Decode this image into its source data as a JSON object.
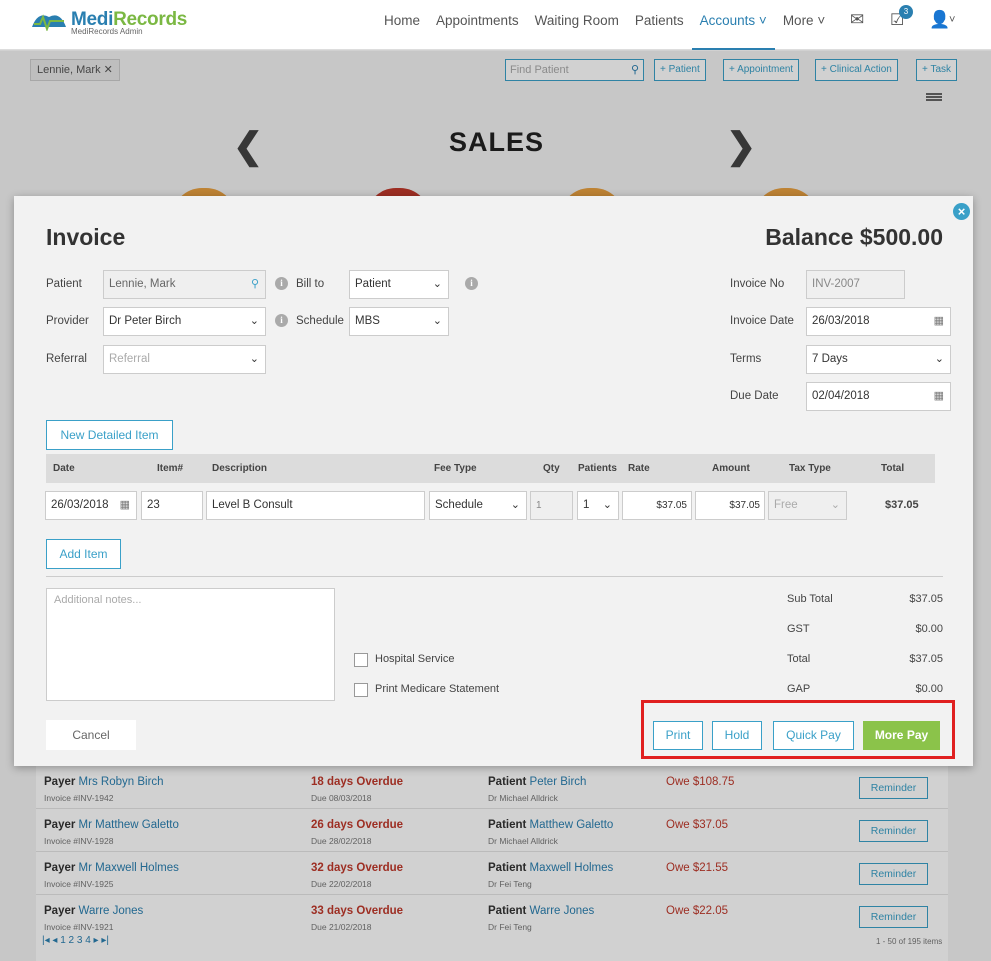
{
  "app": {
    "brand_medi": "Medi",
    "brand_records": "Records",
    "brand_sub": "MediRecords Admin"
  },
  "nav": {
    "items": [
      {
        "label": "Home"
      },
      {
        "label": "Appointments"
      },
      {
        "label": "Waiting Room"
      },
      {
        "label": "Patients"
      },
      {
        "label": "Accounts ˅"
      },
      {
        "label": "More ˅"
      }
    ],
    "tasks_badge": "3"
  },
  "toolbar": {
    "patient_chip": "Lennie, Mark",
    "find_placeholder": "Find Patient",
    "buttons": [
      "+ Patient",
      "+ Appointment",
      "+ Clinical Action",
      "+ Task"
    ]
  },
  "dashboard": {
    "title": "SALES",
    "circle_colors": [
      "#e8a040",
      "#c0392b",
      "#e8a040",
      "#e8a040"
    ]
  },
  "invoice": {
    "title": "Invoice",
    "balance": "Balance $500.00",
    "labels": {
      "patient": "Patient",
      "bill_to": "Bill to",
      "provider": "Provider",
      "schedule": "Schedule",
      "referral": "Referral",
      "invoice_no": "Invoice No",
      "invoice_date": "Invoice Date",
      "terms": "Terms",
      "due_date": "Due Date"
    },
    "values": {
      "patient": "Lennie, Mark",
      "bill_to": "Patient",
      "provider": "Dr Peter Birch",
      "schedule": "MBS",
      "referral_placeholder": "Referral",
      "invoice_no": "INV-2007",
      "invoice_date": "26/03/2018",
      "terms": "7 Days",
      "due_date": "02/04/2018"
    },
    "new_detailed_item": "New Detailed Item",
    "columns": [
      "Date",
      "Item#",
      "Description",
      "Fee Type",
      "Qty",
      "Patients",
      "Rate",
      "Amount",
      "Tax Type",
      "Total"
    ],
    "row": {
      "date": "26/03/2018",
      "item": "23",
      "description": "Level B Consult",
      "fee_type": "Schedule",
      "qty": "1",
      "patients": "1",
      "rate": "$37.05",
      "amount": "$37.05",
      "tax_type": "Free",
      "total": "$37.05"
    },
    "add_item": "Add Item",
    "notes_placeholder": "Additional notes...",
    "checkboxes": {
      "hospital": "Hospital Service",
      "medicare": "Print Medicare Statement"
    },
    "totals": [
      {
        "label": "Sub Total",
        "value": "$37.05"
      },
      {
        "label": "GST",
        "value": "$0.00"
      },
      {
        "label": "Total",
        "value": "$37.05"
      },
      {
        "label": "GAP",
        "value": "$0.00"
      }
    ],
    "actions": {
      "cancel": "Cancel",
      "print": "Print",
      "hold": "Hold",
      "quick_pay": "Quick Pay",
      "more_pay": "More Pay"
    }
  },
  "payers": {
    "payer_label": "Payer",
    "patient_label": "Patient",
    "reminder_label": "Reminder",
    "rows": [
      {
        "payer": "Mrs Robyn Birch",
        "invoice": "Invoice #INV-1942",
        "overdue": "18 days Overdue",
        "due": "Due 08/03/2018",
        "patient": "Peter Birch",
        "doctor": "Dr Michael Alldrick",
        "owe": "Owe $108.75"
      },
      {
        "payer": "Mr Matthew Galetto",
        "invoice": "Invoice #INV-1928",
        "overdue": "26 days Overdue",
        "due": "Due 28/02/2018",
        "patient": "Matthew Galetto",
        "doctor": "Dr Michael Alldrick",
        "owe": "Owe $37.05"
      },
      {
        "payer": "Mr Maxwell Holmes",
        "invoice": "Invoice #INV-1925",
        "overdue": "32 days Overdue",
        "due": "Due 22/02/2018",
        "patient": "Maxwell Holmes",
        "doctor": "Dr Fei Teng",
        "owe": "Owe $21.55"
      },
      {
        "payer": "Warre Jones",
        "invoice": "Invoice #INV-1921",
        "overdue": "33 days Overdue",
        "due": "Due 21/02/2018",
        "patient": "Warre Jones",
        "doctor": "Dr Fei Teng",
        "owe": "Owe $22.05"
      }
    ],
    "pager": "|◂ ◂ 1 2 3 4 ▸ ▸|",
    "count": "1 - 50 of 195 items"
  }
}
